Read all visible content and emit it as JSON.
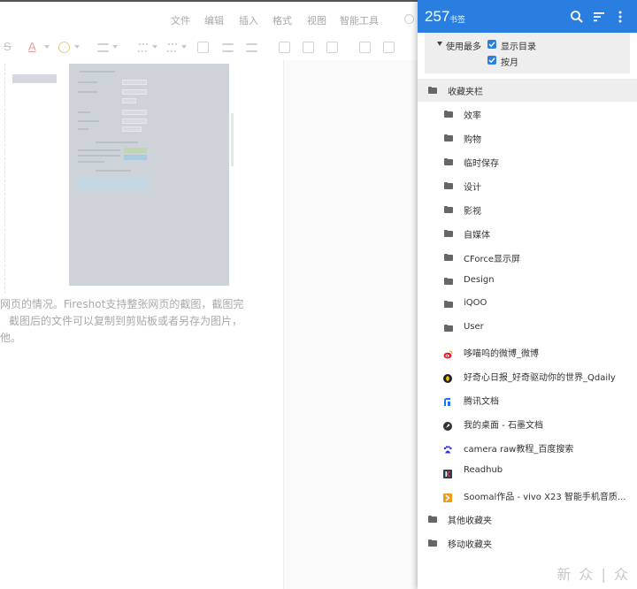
{
  "editor": {
    "menu": [
      "文件",
      "编辑",
      "插入",
      "格式",
      "视图",
      "智能工具"
    ],
    "body_lines": [
      "网页的情况。Fireshot支持整张网页的截图，截图完",
      "截图后的文件可以复制到剪贴板或者另存为图片，",
      "他。"
    ]
  },
  "header": {
    "count": "257",
    "count_label": "书签",
    "icons": [
      "search-icon",
      "sort-icon",
      "more-vert-icon"
    ],
    "bg_color": "#2a7ee0"
  },
  "options": {
    "dropdown_label": "使用最多",
    "show_dirs_label": "显示目录",
    "by_month_label": "按月",
    "show_dirs_checked": true,
    "by_month_checked": true
  },
  "bookmarks": {
    "root": "收藏夹栏",
    "folders": [
      "效率",
      "购物",
      "临时保存",
      "设计",
      "影视",
      "自媒体",
      "CForce显示屏",
      "Design",
      "iQOO",
      "User"
    ],
    "links": [
      {
        "label": "哆喵呜的微博_微博",
        "icon": "weibo-icon"
      },
      {
        "label": "好奇心日报_好奇驱动你的世界_Qdaily",
        "icon": "qdaily-icon"
      },
      {
        "label": "腾讯文档",
        "icon": "tencent-docs-icon"
      },
      {
        "label": "我的桌面 - 石墨文档",
        "icon": "shimo-icon"
      },
      {
        "label": "camera raw教程_百度搜索",
        "icon": "baidu-icon"
      },
      {
        "label": "Readhub",
        "icon": "readhub-icon"
      },
      {
        "label": "Soomal作品 - vivo X23 智能手机音质...",
        "icon": "soomal-icon"
      }
    ],
    "other_folders": [
      "其他收藏夹",
      "移动收藏夹"
    ]
  },
  "watermark": "新 众 | 众"
}
